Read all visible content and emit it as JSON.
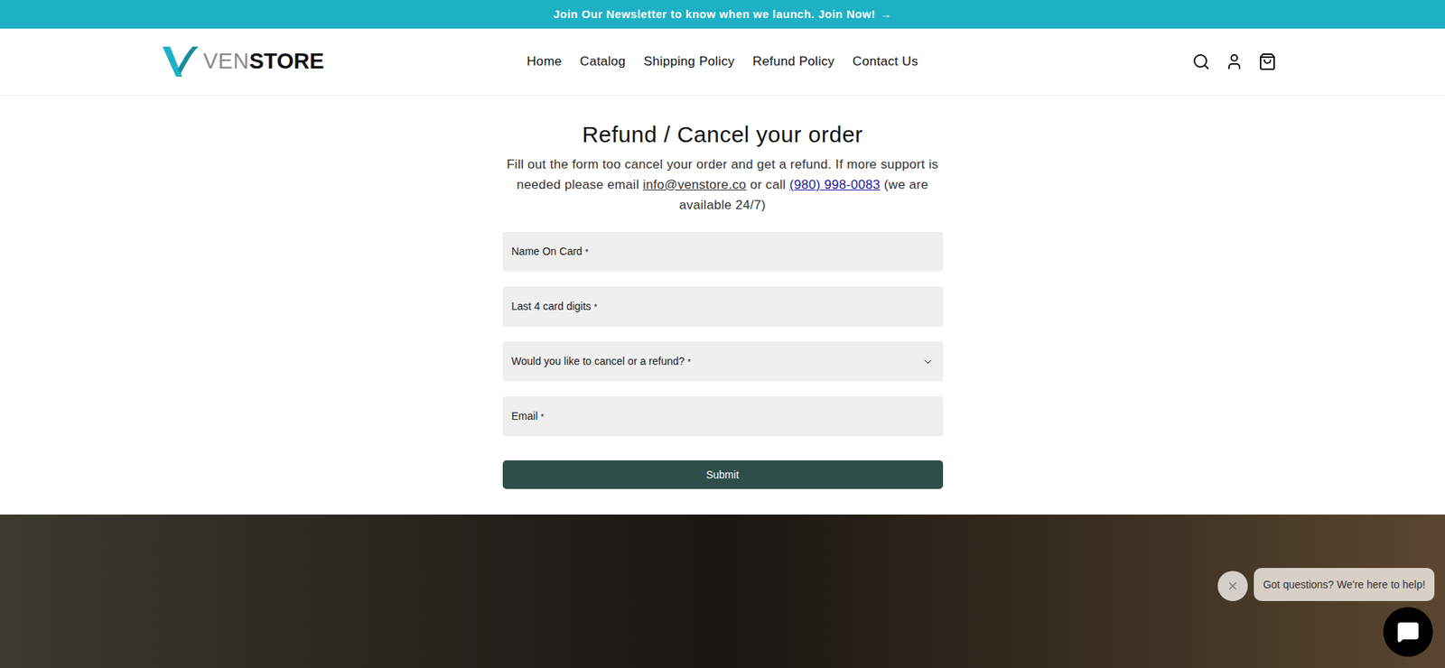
{
  "announcement": {
    "text": "Join Our Newsletter to know when we launch. Join Now!",
    "arrow": "→"
  },
  "logo": {
    "light": "VEN",
    "bold": "STORE"
  },
  "nav": [
    {
      "label": "Home"
    },
    {
      "label": "Catalog"
    },
    {
      "label": "Shipping Policy"
    },
    {
      "label": "Refund Policy"
    },
    {
      "label": "Contact Us"
    }
  ],
  "page": {
    "title": "Refund / Cancel your order",
    "description": {
      "intro": "Fill out the form too cancel your order and get a refund. If more support is needed please email",
      "email": "info@venstore.co",
      "middle": "or call",
      "phone": "(980) 998-0083",
      "outro": "(we are available 24/7)"
    }
  },
  "form": {
    "fields": [
      {
        "label": "Name On Card",
        "required": "*",
        "kind": "input"
      },
      {
        "label": "Last 4 card digits",
        "required": "*",
        "kind": "input"
      },
      {
        "label": "Would you like to cancel or a refund?",
        "required": "*",
        "kind": "select"
      },
      {
        "label": "Email",
        "required": "*",
        "kind": "input"
      }
    ],
    "submit": "Submit"
  },
  "chat": {
    "bubble": "Got questions? We're here to help!"
  }
}
